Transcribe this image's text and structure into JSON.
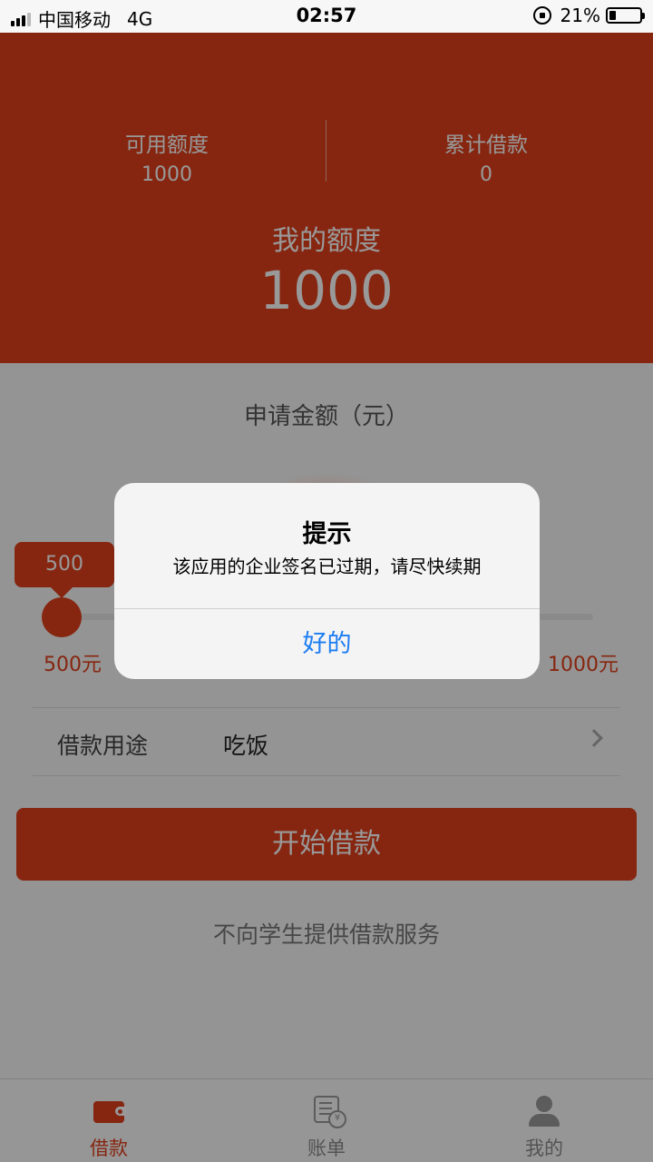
{
  "status_bar": {
    "carrier": "中国移动",
    "network": "4G",
    "time": "02:57",
    "battery": "21%",
    "battery_level": 0.21
  },
  "header": {
    "available_label": "可用额度",
    "available_value": "1000",
    "borrowed_label": "累计借款",
    "borrowed_value": "0",
    "quota_label": "我的额度",
    "quota_value": "1000"
  },
  "apply": {
    "label": "申请金额（元）",
    "slider_value": "500",
    "min_label": "500元",
    "max_label": "1000元"
  },
  "purpose": {
    "label": "借款用途",
    "value": "吃饭"
  },
  "start_button": "开始借款",
  "notice": "不向学生提供借款服务",
  "tabs": [
    {
      "label": "借款",
      "icon": "wallet-icon",
      "active": true
    },
    {
      "label": "账单",
      "icon": "bill-icon",
      "active": false
    },
    {
      "label": "我的",
      "icon": "user-icon",
      "active": false
    }
  ],
  "alert": {
    "title": "提示",
    "message": "该应用的企业签名已过期，请尽快续期",
    "ok": "好的"
  },
  "colors": {
    "brand": "#e0401c",
    "link": "#1b7cf2"
  }
}
